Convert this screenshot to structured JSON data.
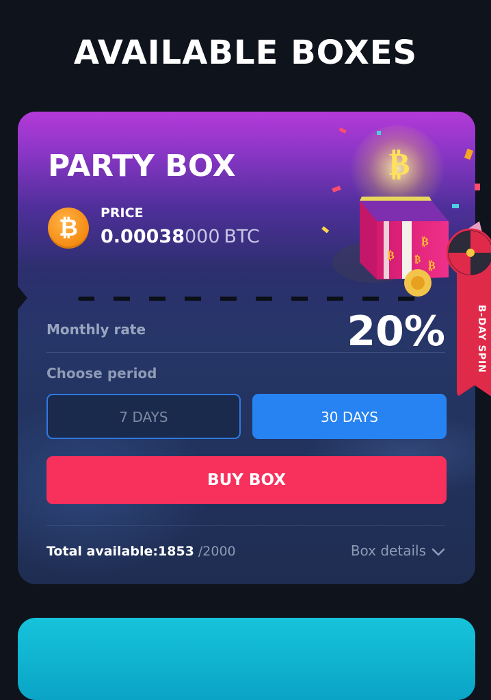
{
  "header": {
    "title": "AVAILABLE BOXES"
  },
  "card": {
    "title": "PARTY BOX",
    "price_label": "PRICE",
    "price_strong": "0.00038",
    "price_dim": "000",
    "price_unit": "BTC",
    "coin_symbol": "₿",
    "monthly_rate_label": "Monthly rate",
    "monthly_rate_value": "20%",
    "choose_period_label": "Choose period",
    "periods": [
      {
        "label": "7 DAYS",
        "selected": false
      },
      {
        "label": "30 DAYS",
        "selected": true
      }
    ],
    "buy_label": "BUY BOX",
    "total_label": "Total available:",
    "total_count": "1853",
    "total_max": "/2000",
    "details_label": "Box details"
  },
  "promo_tab": {
    "label": "B-DAY SPIN"
  },
  "colors": {
    "background": "#0e131c",
    "accent_blue": "#2783f2",
    "buy_red": "#f7305c",
    "coin_orange": "#f7931a"
  },
  "icons": [
    "bitcoin-icon",
    "chevron-down-icon",
    "gift-box-illustration",
    "spin-wheel-icon"
  ]
}
